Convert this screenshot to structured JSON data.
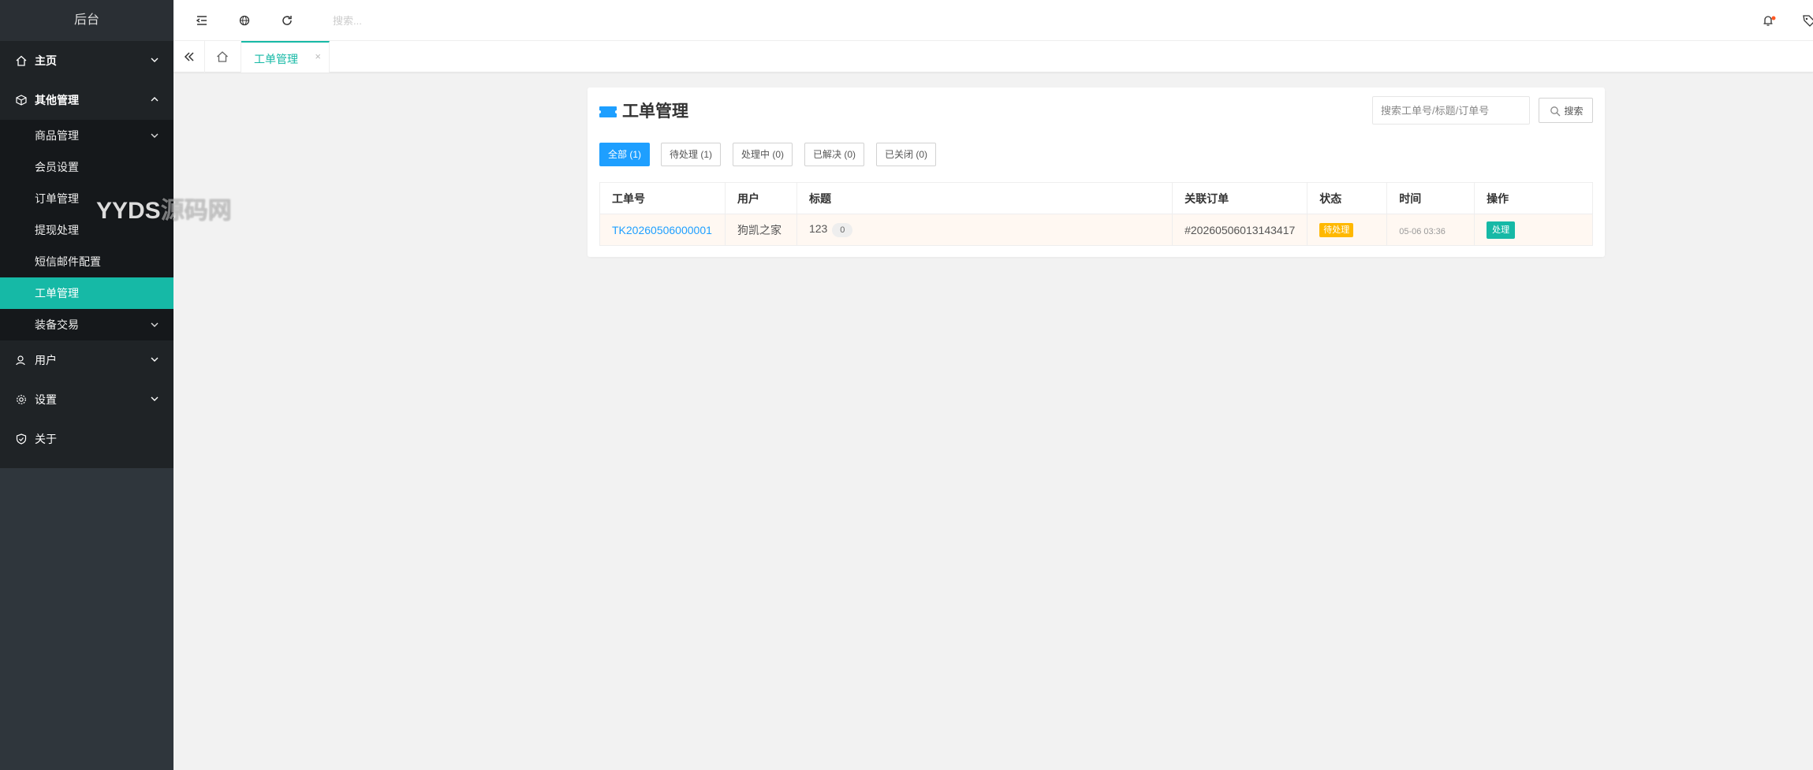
{
  "app": {
    "title": "后台"
  },
  "sidebar": {
    "menu": [
      {
        "label": "主页",
        "icon": "home-icon",
        "expanded": false
      },
      {
        "label": "其他管理",
        "icon": "cube-icon",
        "expanded": true
      },
      {
        "label": "用户",
        "icon": "user-icon",
        "expanded": false
      },
      {
        "label": "设置",
        "icon": "gear-icon",
        "expanded": false
      },
      {
        "label": "关于",
        "icon": "shield-check-icon",
        "expanded": false
      }
    ],
    "submenu": [
      {
        "label": "商品管理",
        "has_children": true
      },
      {
        "label": "会员设置"
      },
      {
        "label": "订单管理"
      },
      {
        "label": "提现处理"
      },
      {
        "label": "短信邮件配置"
      },
      {
        "label": "工单管理",
        "active": true
      },
      {
        "label": "装备交易",
        "has_children": true
      }
    ]
  },
  "watermark": {
    "main": "YYDS",
    "faint": "源码网"
  },
  "header": {
    "search_placeholder": "搜索...",
    "icons": [
      "menu-fold-icon",
      "globe-icon",
      "refresh-icon",
      "bell-icon",
      "tag-icon"
    ]
  },
  "tabs": [
    {
      "label": "工单管理",
      "close": "×"
    }
  ],
  "page": {
    "title": "工单管理",
    "search_placeholder": "搜索工单号/标题/订单号",
    "search_button": "搜索",
    "filters": [
      {
        "label": "全部 (1)",
        "active": true
      },
      {
        "label": "待处理 (1)"
      },
      {
        "label": "处理中 (0)"
      },
      {
        "label": "已解决 (0)"
      },
      {
        "label": "已关闭 (0)"
      }
    ],
    "table": {
      "headers": [
        "工单号",
        "用户",
        "标题",
        "关联订单",
        "状态",
        "时间",
        "操作"
      ],
      "rows": [
        {
          "ticket_no": "TK20260506000001",
          "user": "狗凯之家",
          "title": "123",
          "reply_count": "0",
          "order": "#20260506013143417",
          "status": "待处理",
          "time": "05-06 03:36",
          "action": "处理"
        }
      ]
    }
  },
  "colors": {
    "accent": "#16b9a6",
    "primary": "#1e9fff",
    "warning": "#ffb800",
    "sidebar": "#1f2326",
    "notification_dot": "#ff5722"
  }
}
